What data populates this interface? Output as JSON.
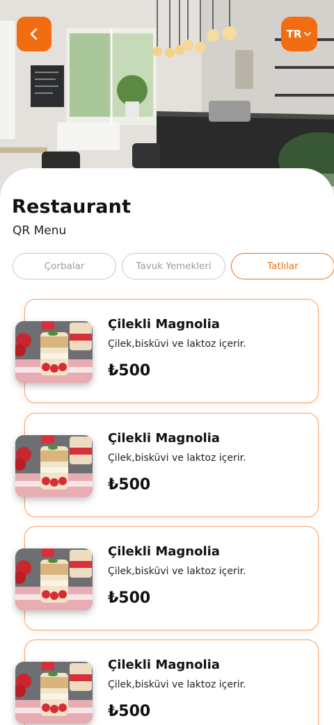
{
  "header": {
    "back_icon": "chevron-left-icon",
    "language_label": "TR",
    "language_icon": "chevron-down-icon",
    "accent_color": "#f26d12"
  },
  "restaurant": {
    "name": "Restaurant",
    "subtitle": "QR Menu"
  },
  "tabs": [
    {
      "label": "Çorbalar",
      "active": false
    },
    {
      "label": "Tavuk Yemekleri",
      "active": false
    },
    {
      "label": "Tatlılar",
      "active": true
    }
  ],
  "items": [
    {
      "name": "Çilekli Magnolia",
      "description": "Çilek,bisküvi ve laktoz içerir.",
      "price": "₺500"
    },
    {
      "name": "Çilekli Magnolia",
      "description": "Çilek,bisküvi ve laktoz içerir.",
      "price": "₺500"
    },
    {
      "name": "Çilekli Magnolia",
      "description": "Çilek,bisküvi ve laktoz içerir.",
      "price": "₺500"
    },
    {
      "name": "Çilekli Magnolia",
      "description": "Çilek,bisküvi ve laktoz içerir.",
      "price": "₺500"
    }
  ]
}
